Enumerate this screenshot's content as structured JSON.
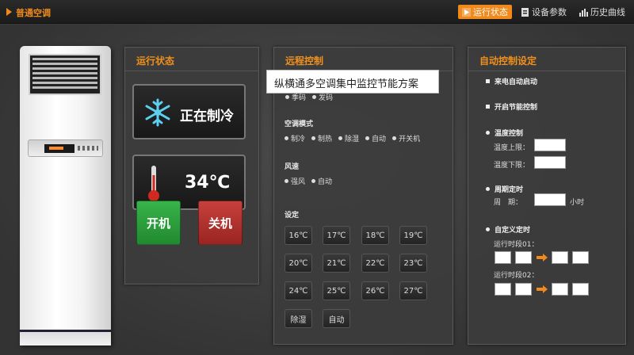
{
  "app": {
    "title": "普通空调"
  },
  "topnav": [
    {
      "label": "运行状态",
      "icon": "play-icon",
      "active": true
    },
    {
      "label": "设备参数",
      "icon": "doc-icon",
      "active": false
    },
    {
      "label": "历史曲线",
      "icon": "bar-chart-icon",
      "active": false
    }
  ],
  "status": {
    "title": "运行状态",
    "mode_text": "正在制冷",
    "temperature": "34℃",
    "on_label": "开机",
    "off_label": "关机"
  },
  "remote": {
    "title": "远程控制",
    "tooltip": "纵横通多空调集中监控节能方案",
    "hidden_row": [
      "季码",
      "发码"
    ],
    "mode_label": "空调模式",
    "modes": [
      "制冷",
      "制热",
      "除湿",
      "自动",
      "开关机"
    ],
    "fan_label": "风速",
    "fans": [
      "强风",
      "自动"
    ],
    "set_label": "设定",
    "temps": [
      "16℃",
      "17℃",
      "18℃",
      "19℃",
      "20℃",
      "21℃",
      "22℃",
      "23℃",
      "24℃",
      "25℃",
      "26℃",
      "27℃"
    ],
    "extra": [
      "除湿",
      "自动"
    ]
  },
  "auto": {
    "title": "自动控制设定",
    "power_restore": "来电自动启动",
    "energy_save": "开启节能控制",
    "temp_control": "温度控制",
    "temp_upper": "温度上限：",
    "temp_lower": "温度下限：",
    "period_timer": "周期定时",
    "period_label": "周　期：",
    "period_unit": "小时",
    "custom_timer": "自定义定时",
    "run_period1": "运行时段01：",
    "run_period2": "运行时段02："
  },
  "colors": {
    "accent": "#f08a1c",
    "on": "#2fa53f",
    "off": "#b8302d"
  }
}
